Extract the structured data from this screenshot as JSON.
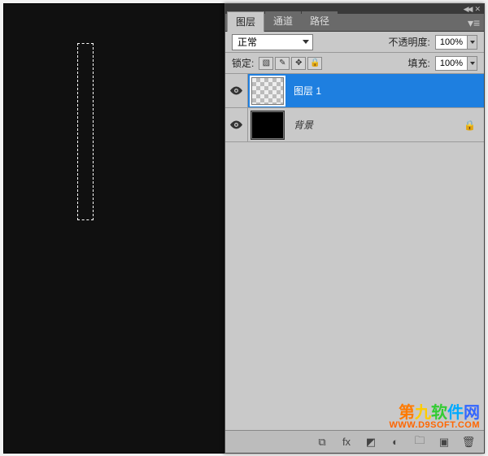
{
  "tabs": {
    "layers": "图层",
    "channels": "通道",
    "paths": "路径"
  },
  "blend": {
    "mode": "正常",
    "opacity_label": "不透明度:",
    "opacity_value": "100%",
    "lock_label": "锁定:",
    "fill_label": "填充:",
    "fill_value": "100%"
  },
  "lock_icons": {
    "pixels": "▧",
    "brush": "✎",
    "move": "✥",
    "all": "🔒"
  },
  "layers": [
    {
      "name": "图层 1",
      "visible": true,
      "selected": true,
      "thumb": "checker",
      "locked": false
    },
    {
      "name": "背景",
      "visible": true,
      "selected": false,
      "thumb": "black",
      "locked": true
    }
  ],
  "bottom_icons": {
    "link": "⧉",
    "fx": "fx",
    "mask": "◩",
    "adjust": "◐",
    "folder": "🗀",
    "new": "▣",
    "trash": "🗑"
  },
  "watermark": {
    "line1": "第九软件网",
    "line2": "WWW.D9SOFT.COM"
  },
  "topbar": {
    "collapse": "◀◀",
    "close": "✕"
  }
}
